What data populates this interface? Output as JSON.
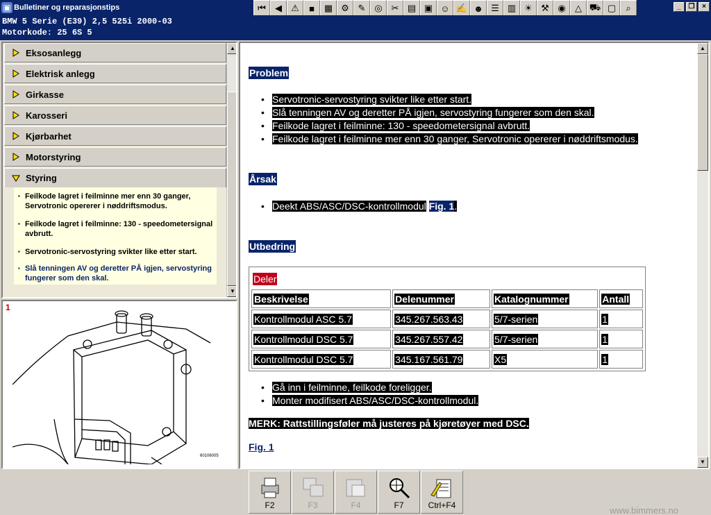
{
  "window": {
    "title": "Bulletiner og reparasjonstips",
    "app_icon": "BMW",
    "controls": [
      "minimize-icon",
      "restore-icon",
      "close-icon"
    ]
  },
  "toolbar": {
    "buttons": [
      {
        "name": "first-page-icon",
        "glyph": "⏮"
      },
      {
        "name": "previous-icon",
        "glyph": "◀"
      },
      {
        "name": "warning-icon",
        "glyph": "⚠"
      },
      {
        "name": "info-icon",
        "glyph": "■"
      },
      {
        "name": "diagram-icon",
        "glyph": "▦"
      },
      {
        "name": "settings-icon",
        "glyph": "⚙"
      },
      {
        "name": "tool-icon",
        "glyph": "✎"
      },
      {
        "name": "wheel-icon",
        "glyph": "◎"
      },
      {
        "name": "wrench-icon",
        "glyph": "✂"
      },
      {
        "name": "document-icon",
        "glyph": "▤"
      },
      {
        "name": "disk-icon",
        "glyph": "▣"
      },
      {
        "name": "people-icon",
        "glyph": "☺"
      },
      {
        "name": "edit-icon",
        "glyph": "✍"
      },
      {
        "name": "person-icon",
        "glyph": "☻"
      },
      {
        "name": "list-icon",
        "glyph": "☰"
      },
      {
        "name": "chart-icon",
        "glyph": "▥"
      },
      {
        "name": "warning-light-icon",
        "glyph": "☀"
      },
      {
        "name": "engine-icon",
        "glyph": "⚒"
      },
      {
        "name": "gauge-icon",
        "glyph": "◉"
      },
      {
        "name": "hazard-icon",
        "glyph": "△"
      },
      {
        "name": "car-icon",
        "glyph": "⛟"
      },
      {
        "name": "box-icon",
        "glyph": "▢"
      },
      {
        "name": "search-icon",
        "glyph": "⌕"
      }
    ]
  },
  "vehicle": {
    "line": "BMW   5 Serie (E39) 2,5 525i 2000-03",
    "motor": "Motorkode: 25 6S 5"
  },
  "nav": {
    "items": [
      {
        "label": "Eksosanlegg"
      },
      {
        "label": "Elektrisk anlegg"
      },
      {
        "label": "Girkasse"
      },
      {
        "label": "Karosseri"
      },
      {
        "label": "Kjørbarhet"
      },
      {
        "label": "Motorstyring"
      },
      {
        "label": "Styring"
      }
    ],
    "sub_items": [
      {
        "label": "Feilkode lagret i feilminne mer enn 30 ganger, Servotronic opererer i nøddriftsmodus."
      },
      {
        "label": "Feilkode lagret i feilminne: 130 - speedometersignal avbrutt."
      },
      {
        "label": "Servotronic-servostyring svikter like etter start."
      },
      {
        "label": "Slå tenningen AV og deretter PÅ igjen, servostyring fungerer som den skal."
      }
    ]
  },
  "figure": {
    "number": "1",
    "code": "60106005"
  },
  "content": {
    "problem_heading": "Problem",
    "problem_items": [
      "Servotronic-servostyring svikter like etter start.",
      "Slå tenningen AV og deretter PÅ igjen, servostyring fungerer som den skal.",
      "Feilkode lagret i feilminne: 130 - speedometersignal avbrutt.",
      "Feilkode lagret i feilminne mer enn 30 ganger, Servotronic opererer i nøddriftsmodus."
    ],
    "cause_heading": "Årsak",
    "cause_text": "Deekt ABS/ASC/DSC-kontrollmodul",
    "cause_link": "Fig. 1",
    "cause_end": ".",
    "fix_heading": "Utbedring",
    "parts": {
      "caption": "Deler",
      "headers": [
        "Beskrivelse",
        "Delenummer",
        "Katalognummer",
        "Antall"
      ],
      "rows": [
        [
          "Kontrollmodul ASC 5.7",
          "345.267.563.43",
          "5/7-serien",
          "1"
        ],
        [
          "Kontrollmodul DSC 5.7",
          "345.267.557.42",
          "5/7-serien",
          "1"
        ],
        [
          "Kontrollmodul DSC 5.7",
          "345.167.561.79",
          "X5",
          "1"
        ]
      ]
    },
    "steps": [
      "Gå inn i feilminne, feilkode foreligger.",
      "Monter modifisert ABS/ASC/DSC-kontrollmodul."
    ],
    "note": "MERK: Rattstillingsføler må justeres på kjøretøyer med DSC.",
    "fig_link": "Fig. 1"
  },
  "fkeys": [
    {
      "label": "F2",
      "icon": "printer-icon",
      "disabled": false
    },
    {
      "label": "F3",
      "icon": "copy-image-icon",
      "disabled": true
    },
    {
      "label": "F4",
      "icon": "paste-image-icon",
      "disabled": true
    },
    {
      "label": "F7",
      "icon": "zoom-icon",
      "disabled": false
    },
    {
      "label": "Ctrl+F4",
      "icon": "notes-icon",
      "disabled": false
    }
  ],
  "watermark": "www.bimmers.no",
  "colors": {
    "titlebar": "#0a246a",
    "highlight": "#000000",
    "heading_bg": "#0a246a",
    "caption_bg": "#c0001a",
    "nav_bg": "#d4d0c8",
    "note_bg": "#ffffe1"
  }
}
